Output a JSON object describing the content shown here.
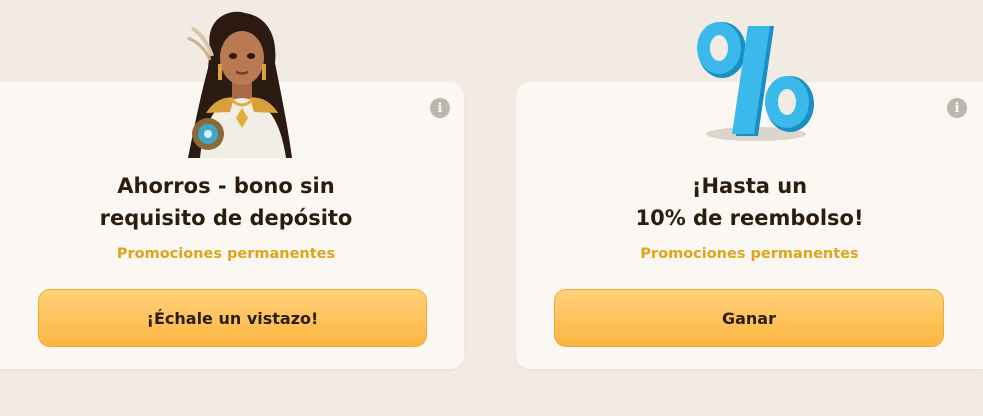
{
  "promos": [
    {
      "title_line1": "Ahorros - bono sin",
      "title_line2": "requisito de depósito",
      "subtitle": "Promociones permanentes",
      "button_label": "¡Échale un vistazo!",
      "info_icon": "info-icon",
      "image": "woman-character-illustration"
    },
    {
      "title_line1": "¡Hasta un",
      "title_line2": "10% de reembolso!",
      "subtitle": "Promociones permanentes",
      "button_label": "Ganar",
      "info_icon": "info-icon",
      "image": "percent-sign-3d"
    }
  ],
  "colors": {
    "background": "#f2ebe3",
    "card": "#fbf8f4",
    "accent": "#e0a31a",
    "button_top": "#ffd27a",
    "button_bottom": "#fbb540",
    "text_dark": "#2b1d0e"
  }
}
